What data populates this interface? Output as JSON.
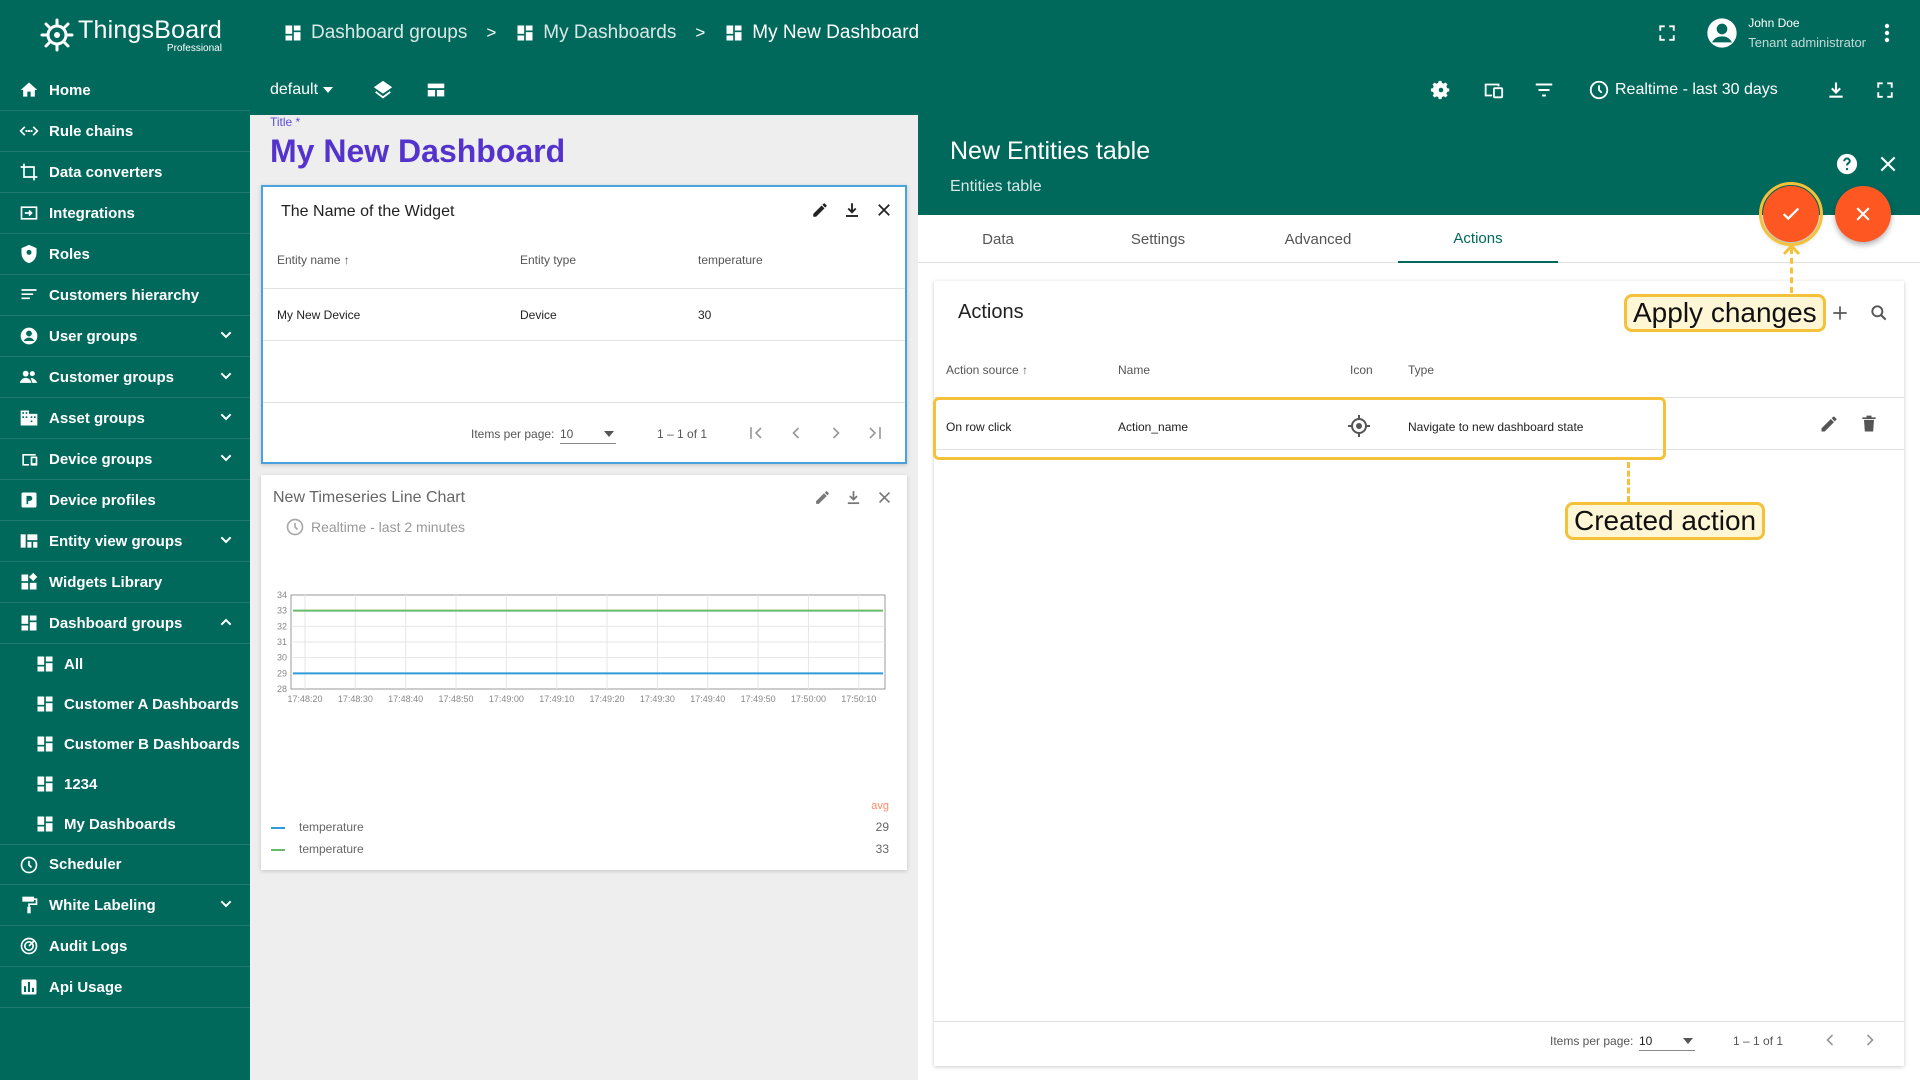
{
  "app": {
    "logo_name": "ThingsBoard",
    "logo_sub": "Professional"
  },
  "sidebar": {
    "items": [
      {
        "label": "Home",
        "icon": "home-icon"
      },
      {
        "label": "Rule chains",
        "icon": "rule-chain-icon"
      },
      {
        "label": "Data converters",
        "icon": "converter-icon"
      },
      {
        "label": "Integrations",
        "icon": "integration-icon"
      },
      {
        "label": "Roles",
        "icon": "shield-icon"
      },
      {
        "label": "Customers hierarchy",
        "icon": "hierarchy-icon"
      },
      {
        "label": "User groups",
        "icon": "account-icon",
        "expandable": true
      },
      {
        "label": "Customer groups",
        "icon": "customers-icon",
        "expandable": true
      },
      {
        "label": "Asset groups",
        "icon": "domain-icon",
        "expandable": true
      },
      {
        "label": "Device groups",
        "icon": "devices-icon",
        "expandable": true
      },
      {
        "label": "Device profiles",
        "icon": "device-profile-icon"
      },
      {
        "label": "Entity view groups",
        "icon": "view-quilt-icon",
        "expandable": true
      },
      {
        "label": "Widgets Library",
        "icon": "widgets-icon"
      },
      {
        "label": "Dashboard groups",
        "icon": "dashboard-icon",
        "expanded": true
      }
    ],
    "sub_items": [
      {
        "label": "All"
      },
      {
        "label": "Customer A Dashboards"
      },
      {
        "label": "Customer B Dashboards"
      },
      {
        "label": "1234"
      },
      {
        "label": "My Dashboards"
      }
    ],
    "bottom_items": [
      {
        "label": "Scheduler",
        "icon": "clock-icon"
      },
      {
        "label": "White Labeling",
        "icon": "format-paint-icon",
        "expandable": true
      },
      {
        "label": "Audit Logs",
        "icon": "track-changes-icon"
      },
      {
        "label": "Api Usage",
        "icon": "insert-chart-icon"
      }
    ]
  },
  "breadcrumb": [
    "Dashboard groups",
    "My Dashboards",
    "My New Dashboard"
  ],
  "breadcrumb_sep": ">",
  "user": {
    "name": "John Doe",
    "role": "Tenant administrator"
  },
  "toolbar": {
    "state": "default",
    "timewindow": "Realtime - last 30 days"
  },
  "dashboard": {
    "title_label": "Title *",
    "title": "My New Dashboard"
  },
  "widget1": {
    "title": "The Name of the Widget",
    "columns": [
      "Entity name",
      "Entity type",
      "temperature"
    ],
    "rows": [
      [
        "My New Device",
        "Device",
        "30"
      ]
    ],
    "items_per_page_label": "Items per page:",
    "items_per_page": "10",
    "range": "1 – 1 of 1"
  },
  "widget2": {
    "title": "New Timeseries Line Chart",
    "timewindow": "Realtime - last 2 minutes"
  },
  "chart_data": {
    "type": "line",
    "x": [
      "17:48:20",
      "17:48:30",
      "17:48:40",
      "17:48:50",
      "17:49:00",
      "17:49:10",
      "17:49:20",
      "17:49:30",
      "17:49:40",
      "17:49:50",
      "17:50:00",
      "17:50:10"
    ],
    "yticks": [
      "34",
      "33",
      "32",
      "31",
      "30",
      "29",
      "28"
    ],
    "ylim": [
      28,
      34
    ],
    "series": [
      {
        "name": "temperature",
        "color": "#2f9bdb",
        "value": 29,
        "avg": "29"
      },
      {
        "name": "temperature",
        "color": "#66bb6a",
        "value": 33,
        "avg": "33"
      }
    ],
    "legend_header": "avg",
    "grid": true
  },
  "panel": {
    "title": "New Entities table",
    "subtitle": "Entities table",
    "tabs": [
      "Data",
      "Settings",
      "Advanced",
      "Actions"
    ],
    "active_tab": "Actions",
    "card_title": "Actions",
    "columns": [
      "Action source",
      "Name",
      "Icon",
      "Type"
    ],
    "row": {
      "source": "On row click",
      "name": "Action_name",
      "icon": "my-location-icon",
      "type": "Navigate to new dashboard state"
    },
    "items_per_page_label": "Items per page:",
    "items_per_page": "10",
    "range": "1 – 1 of 1"
  },
  "callouts": {
    "apply": "Apply changes",
    "created": "Created action"
  },
  "colors": {
    "primary": "#00695c",
    "accent": "#ff5722",
    "highlight": "#f4c23a",
    "title": "#5433cd"
  }
}
